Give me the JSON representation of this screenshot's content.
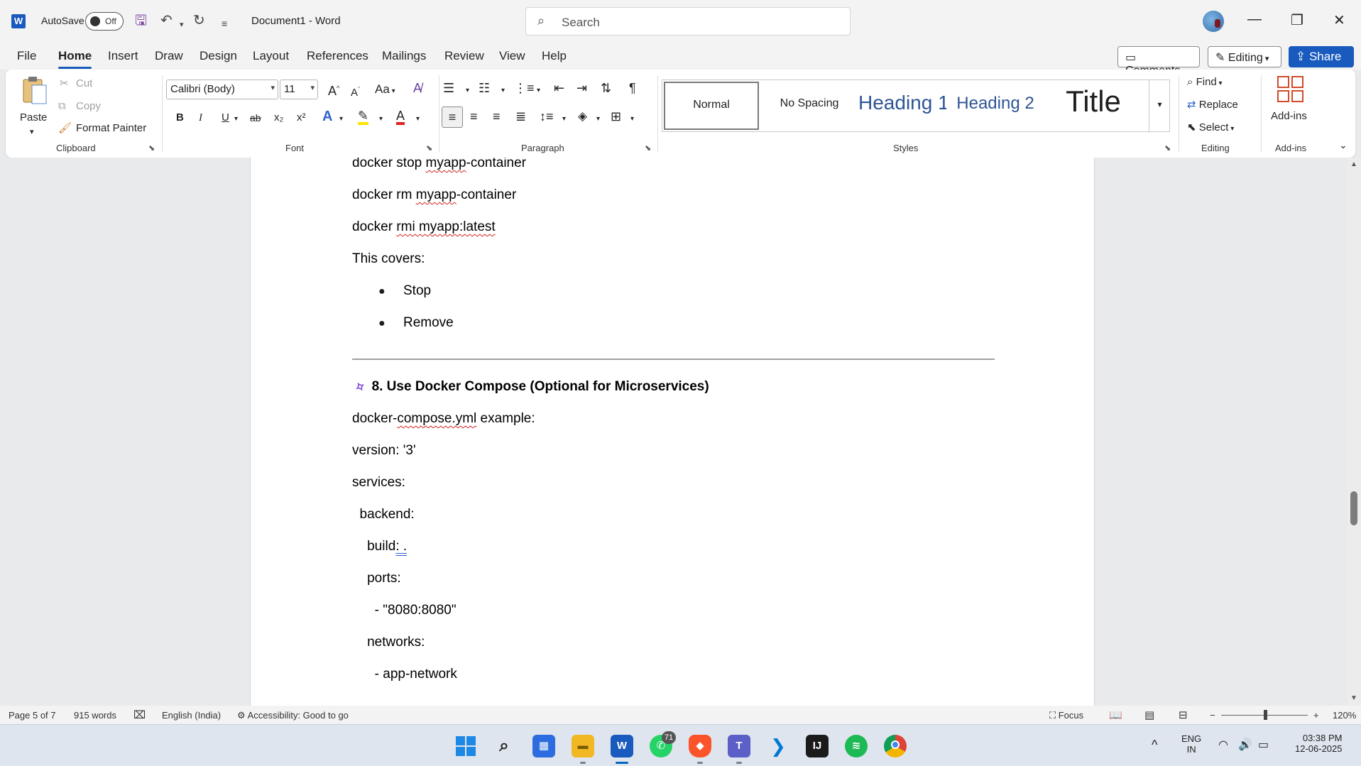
{
  "titlebar": {
    "app_letter": "W",
    "autosave_label": "AutoSave",
    "autosave_state": "Off",
    "doc_title": "Document1  -  Word",
    "search_placeholder": "Search",
    "minimize": "—",
    "restore": "❐",
    "close": "✕"
  },
  "tabs": [
    "File",
    "Home",
    "Insert",
    "Draw",
    "Design",
    "Layout",
    "References",
    "Mailings",
    "Review",
    "View",
    "Help"
  ],
  "active_tab": "Home",
  "header_buttons": {
    "comments": "Comments",
    "editing": "Editing",
    "share": "Share"
  },
  "ribbon": {
    "clipboard": {
      "label": "Clipboard",
      "paste": "Paste",
      "cut": "Cut",
      "copy": "Copy",
      "format_painter": "Format Painter"
    },
    "font": {
      "label": "Font",
      "font_name": "Calibri (Body)",
      "font_size": "11",
      "bold": "B",
      "italic": "I",
      "underline": "U",
      "strike": "ab",
      "sub": "x₂",
      "sup": "x²",
      "change_case": "Aa",
      "grow": "A",
      "shrink": "A"
    },
    "paragraph": {
      "label": "Paragraph"
    },
    "styles": {
      "label": "Styles",
      "items": [
        "Normal",
        "No Spacing",
        "Heading 1",
        "Heading 2",
        "Title"
      ]
    },
    "editing": {
      "label": "Editing",
      "find": "Find",
      "replace": "Replace",
      "select": "Select"
    },
    "addins": {
      "label": "Add-ins",
      "button": "Add-ins"
    }
  },
  "document": {
    "line1": {
      "a": "docker stop ",
      "b": "myapp",
      "c": "-container"
    },
    "line2": {
      "a": "docker rm ",
      "b": "myapp",
      "c": "-container"
    },
    "line3": {
      "a": "docker ",
      "b": "rmi myapp:latest"
    },
    "covers": "This covers:",
    "bullets": [
      "Stop",
      "Remove"
    ],
    "heading": "8. Use Docker Compose (Optional for Microservices)",
    "compose_intro": {
      "a": "docker-",
      "b": "compose.yml",
      "c": " example:"
    },
    "code": {
      "version": "version: '3'",
      "services": "services:",
      "backend": "  backend:",
      "build_a": "    build",
      "build_b": ": .",
      "ports": "    ports:",
      "port_val": "      - \"8080:8080\"",
      "networks": "    networks:",
      "net_val": "      - app-network"
    }
  },
  "statusbar": {
    "page": "Page 5 of 7",
    "words": "915 words",
    "language": "English (India)",
    "accessibility": "Accessibility: Good to go",
    "focus": "Focus",
    "zoom": "120%"
  },
  "taskbar": {
    "whatsapp_badge": "71",
    "lang_top": "ENG",
    "lang_bottom": "IN",
    "time": "03:38 PM",
    "date": "12-06-2025"
  }
}
